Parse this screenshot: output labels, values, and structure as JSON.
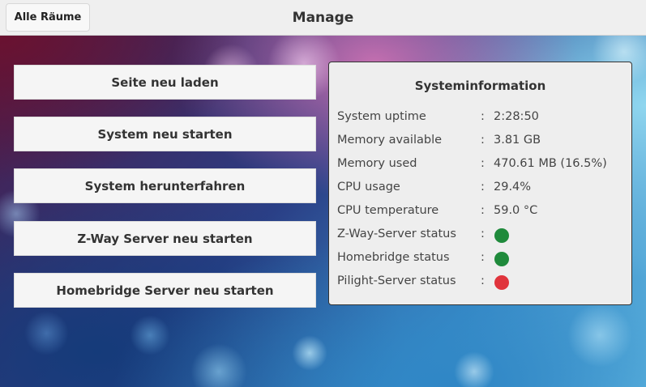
{
  "header": {
    "back_button": "Alle Räume",
    "title": "Manage"
  },
  "actions": [
    {
      "label": "Seite neu laden"
    },
    {
      "label": "System neu starten"
    },
    {
      "label": "System herunterfahren"
    },
    {
      "label": "Z-Way Server neu starten"
    },
    {
      "label": "Homebridge Server neu starten"
    }
  ],
  "sysinfo": {
    "title": "Systeminformation",
    "separator": ":",
    "rows": [
      {
        "label": "System uptime",
        "value": "2:28:50"
      },
      {
        "label": "Memory available",
        "value": "3.81 GB"
      },
      {
        "label": "Memory used",
        "value": "470.61 MB (16.5%)"
      },
      {
        "label": "CPU usage",
        "value": "29.4%"
      },
      {
        "label": "CPU temperature",
        "value": "59.0 °C"
      }
    ],
    "status_rows": [
      {
        "label": "Z-Way-Server status",
        "status": "running",
        "color": "#1f8a3b"
      },
      {
        "label": "Homebridge status",
        "status": "running",
        "color": "#1f8a3b"
      },
      {
        "label": "Pilight-Server status",
        "status": "stopped",
        "color": "#e0343c"
      }
    ]
  }
}
